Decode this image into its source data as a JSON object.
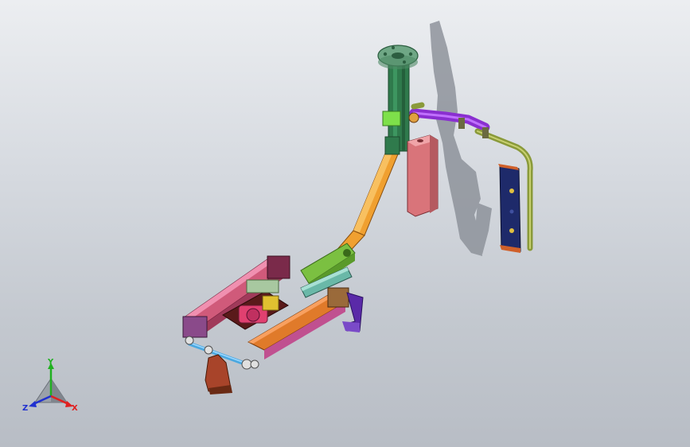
{
  "viewport": {
    "background_top": "#eceef1",
    "background_bottom": "#b8bdc5"
  },
  "triad": {
    "x_label": "X",
    "y_label": "Y",
    "z_label": "Z",
    "x_color": "#e02020",
    "y_color": "#20b020",
    "z_color": "#2030d0"
  },
  "model": {
    "part_colors": {
      "column": "#2f7a4c",
      "flange": "#6fa785",
      "arm": "#f0a030",
      "pink_block": "#d9747a",
      "purple_pipe": "#8a2fd0",
      "olive_pipe": "#8a9a3a",
      "navy_plate": "#1e2a6a",
      "pink_rail": "#d05a7a",
      "orange_rail": "#e07a2a",
      "lime_bracket": "#7bc041",
      "brown_foot": "#a8442a",
      "violet_foot": "#5a2aa8",
      "dark_red_base": "#5a1a1a"
    }
  }
}
